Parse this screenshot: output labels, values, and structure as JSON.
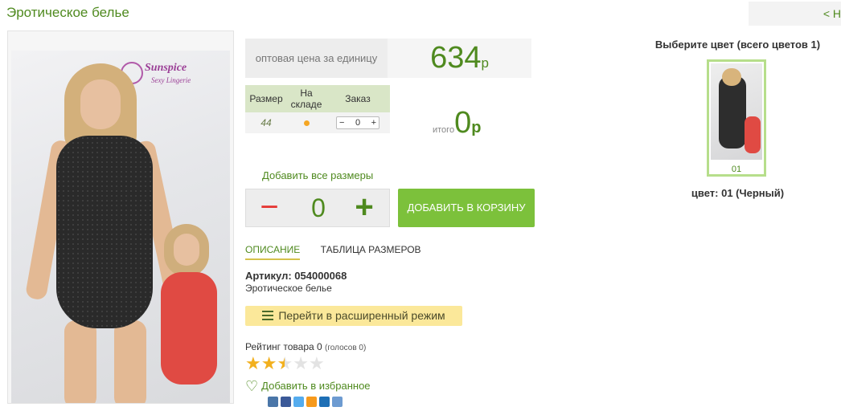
{
  "page": {
    "title": "Эротическое белье",
    "back_link": "< Н"
  },
  "price": {
    "label": "оптовая цена за единицу",
    "value": "634",
    "currency": "р"
  },
  "size_table": {
    "headers": [
      "Размер",
      "На складе",
      "Заказ"
    ],
    "rows": [
      {
        "size": "44",
        "qty": "0"
      }
    ]
  },
  "stepper_symbols": {
    "minus": "−",
    "plus": "+"
  },
  "total": {
    "label": "итого",
    "value": "0",
    "currency": "р"
  },
  "add_all_sizes": "Добавить все размеры",
  "quantity": {
    "value": "0",
    "minus": "−",
    "plus": "+"
  },
  "cart_button": "Добавить в корзину",
  "tabs": [
    {
      "label": "ОПИСАНИЕ",
      "active": true
    },
    {
      "label": "ТАБЛИЦА РАЗМЕРОВ",
      "active": false
    }
  ],
  "product": {
    "sku": "Артикул: 054000068",
    "description": "Эротическое белье"
  },
  "photo": {
    "brand_name": "Sunspice",
    "brand_sub": "Sexy Lingerie"
  },
  "extended_mode_button": "Перейти в расширенный режим",
  "rating": {
    "label": "Рейтинг товара 0",
    "votes": "(голосов 0)",
    "value": 2.5,
    "max": 5
  },
  "favorite": "Добавить в избранное",
  "colors": {
    "title": "Выберите цвет (всего цветов 1)",
    "items": [
      {
        "code": "01"
      }
    ],
    "selected_caption": "цвет: 01 (Черный)"
  },
  "social_colors": [
    "#4a76a8",
    "#3b5998",
    "#55acee",
    "#f79a1c",
    "#1e6fb5",
    "#6d9bd1"
  ],
  "theme": {
    "accent": "#4f8a1f",
    "button_green": "#7cc13b",
    "stock_dot": "#f5a623",
    "minus_red": "#e53935"
  }
}
